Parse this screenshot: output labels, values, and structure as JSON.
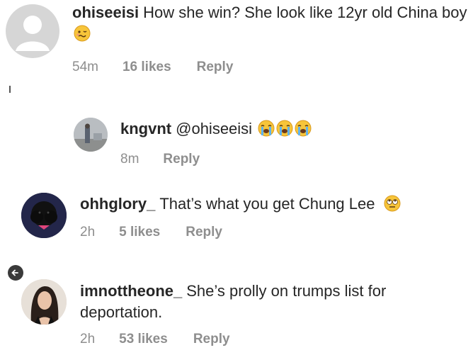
{
  "comments": [
    {
      "username": "ohiseeisi",
      "text": "How she win? She look like 12yr old China boy",
      "emojis": [
        "woozy-face"
      ],
      "time": "54m",
      "likes": "16 likes",
      "reply": "Reply"
    },
    {
      "username": "kngvnt",
      "text": "@ohiseeisi",
      "emojis": [
        "loudly-crying-face",
        "loudly-crying-face",
        "loudly-crying-face"
      ],
      "time": "8m",
      "reply": "Reply"
    },
    {
      "username": "ohhglory_",
      "text": "That’s what you get Chung Lee",
      "emojis": [
        "rolling-eyes-face"
      ],
      "time": "2h",
      "likes": "5 likes",
      "reply": "Reply"
    },
    {
      "username": "imnottheone_",
      "text": "She’s prolly on trumps list for deportation.",
      "time": "2h",
      "likes": "53 likes",
      "reply": "Reply"
    }
  ],
  "colors": {
    "text": "#262626",
    "meta": "#8e8e8e",
    "placeholder_avatar": "#d6d6d6"
  },
  "icons": {
    "back": "arrow-left-icon"
  }
}
